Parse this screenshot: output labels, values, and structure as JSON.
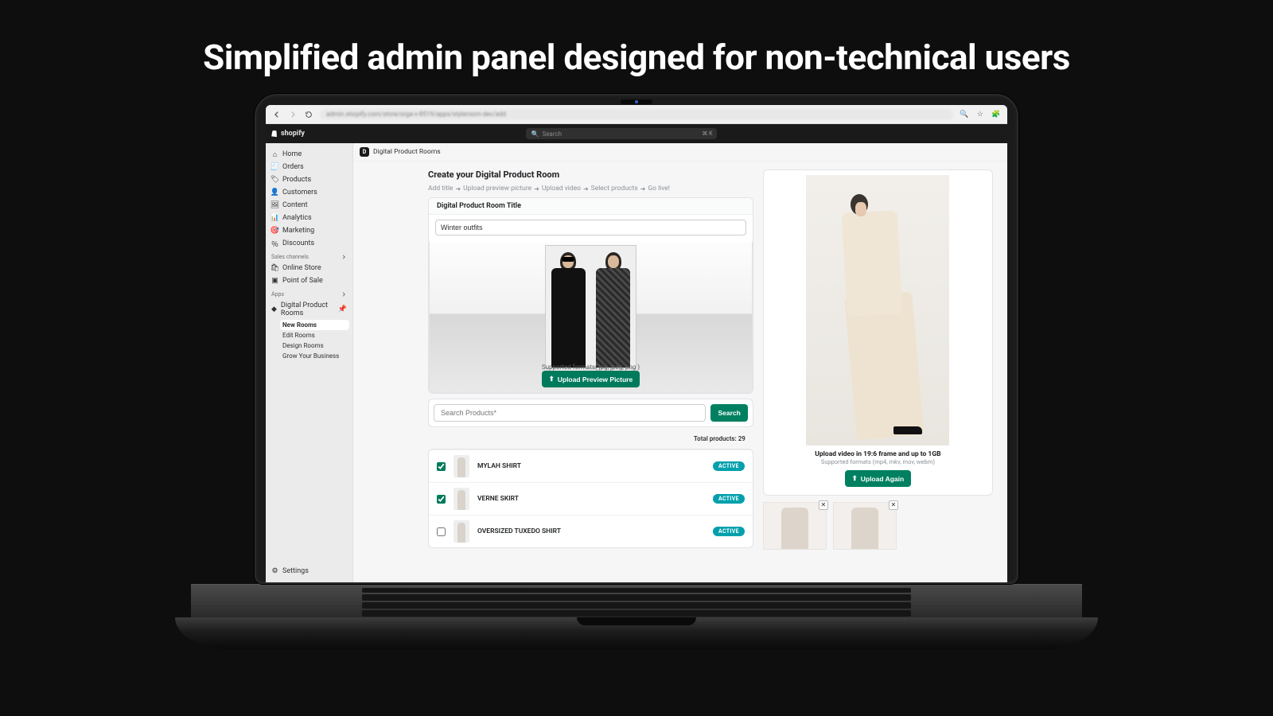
{
  "hero": {
    "title": "Simplified admin panel designed for non-technical users"
  },
  "browser": {
    "url": "admin.shopify.com/store/orga-v-8519/apps/styleroom-dev/add"
  },
  "topbar": {
    "brand": "shopify",
    "search_placeholder": "Search",
    "kbd": "⌘ K"
  },
  "sidebar": {
    "nav": [
      {
        "id": "home",
        "label": "Home",
        "icon": "home-icon"
      },
      {
        "id": "orders",
        "label": "Orders",
        "icon": "orders-icon"
      },
      {
        "id": "products",
        "label": "Products",
        "icon": "products-icon"
      },
      {
        "id": "customers",
        "label": "Customers",
        "icon": "customers-icon"
      },
      {
        "id": "content",
        "label": "Content",
        "icon": "content-icon"
      },
      {
        "id": "analytics",
        "label": "Analytics",
        "icon": "analytics-icon"
      },
      {
        "id": "marketing",
        "label": "Marketing",
        "icon": "marketing-icon"
      },
      {
        "id": "discounts",
        "label": "Discounts",
        "icon": "discounts-icon"
      }
    ],
    "channels_heading": "Sales channels",
    "channels": [
      {
        "id": "online-store",
        "label": "Online Store"
      },
      {
        "id": "pos",
        "label": "Point of Sale"
      }
    ],
    "apps_heading": "Apps",
    "app": {
      "label": "Digital Product Rooms"
    },
    "app_sub": [
      {
        "id": "new-rooms",
        "label": "New Rooms",
        "selected": true
      },
      {
        "id": "edit-rooms",
        "label": "Edit Rooms"
      },
      {
        "id": "design-rooms",
        "label": "Design Rooms"
      },
      {
        "id": "grow",
        "label": "Grow Your Business"
      }
    ],
    "settings": "Settings"
  },
  "breadcrumb": {
    "app": "Digital Product Rooms"
  },
  "page": {
    "title": "Create your Digital Product Room",
    "steps": [
      "Add title",
      "Upload preview picture",
      "Upload video",
      "Select products",
      "Go live!"
    ]
  },
  "title_card": {
    "label": "Digital Product Room Title",
    "value": "Winter outfits"
  },
  "preview": {
    "supported": "Supported formats( jpg, jpeg, png )",
    "upload_btn": "Upload Preview Picture"
  },
  "search": {
    "placeholder": "Search Products*",
    "button": "Search",
    "total_label": "Total products:",
    "total_value": "29"
  },
  "products": [
    {
      "name": "MYLAH SHIRT",
      "status": "ACTIVE",
      "checked": true
    },
    {
      "name": "VERNE SKIRT",
      "status": "ACTIVE",
      "checked": true
    },
    {
      "name": "OVERSIZED TUXEDO SHIRT",
      "status": "ACTIVE",
      "checked": false
    }
  ],
  "video": {
    "title": "Upload video in 19:6 frame and up to 1GB",
    "sub": "Supported formats (mp4, mkv, mov, webm)",
    "btn": "Upload Again"
  }
}
